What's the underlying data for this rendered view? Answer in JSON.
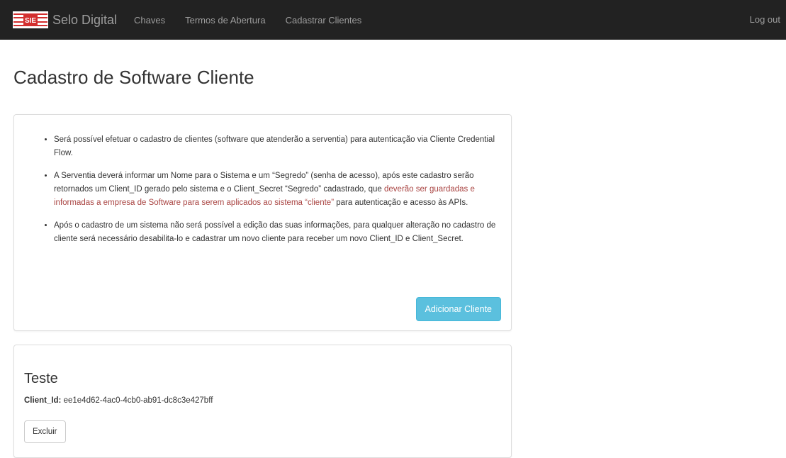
{
  "navbar": {
    "brand": "Selo Digital",
    "logo_text": "SIE",
    "links": [
      "Chaves",
      "Termos de Abertura",
      "Cadastrar Clientes"
    ],
    "logout": "Log out"
  },
  "page": {
    "title": "Cadastro de Software Cliente"
  },
  "info": {
    "items": [
      {
        "text": "Será possível efetuar o cadastro de clientes (software que atenderão a serventia) para autenticação via Cliente Credential Flow."
      },
      {
        "text_before": "A Serventia deverá informar um Nome para o Sistema e um “Segredo” (senha de acesso), após este cadastro serão retornados um Client_ID gerado pelo sistema e o Client_Secret “Segredo” cadastrado, que ",
        "text_highlight": "deverão ser guardadas e informadas a empresa de Software para serem aplicados ao sistema “cliente”",
        "text_after": " para autenticação e acesso às APIs."
      },
      {
        "text": "Após o cadastro de um sistema não será possível a edição das suas informações, para qualquer alteração no cadastro de cliente será necessário desabilita-lo e cadastrar um novo cliente para receber um novo Client_ID e Client_Secret."
      }
    ],
    "add_button": "Adicionar Cliente"
  },
  "client": {
    "name": "Teste",
    "id_label": "Client_Id:",
    "id_value": "ee1e4d62-4ac0-4cb0-ab91-dc8c3e427bff",
    "delete_button": "Excluir"
  },
  "colors": {
    "navbar_bg": "#222222",
    "nav_text": "#9d9d9d",
    "info_button": "#5bc0de",
    "highlight_text": "#a94442",
    "logo_red": "#d32f2f"
  }
}
